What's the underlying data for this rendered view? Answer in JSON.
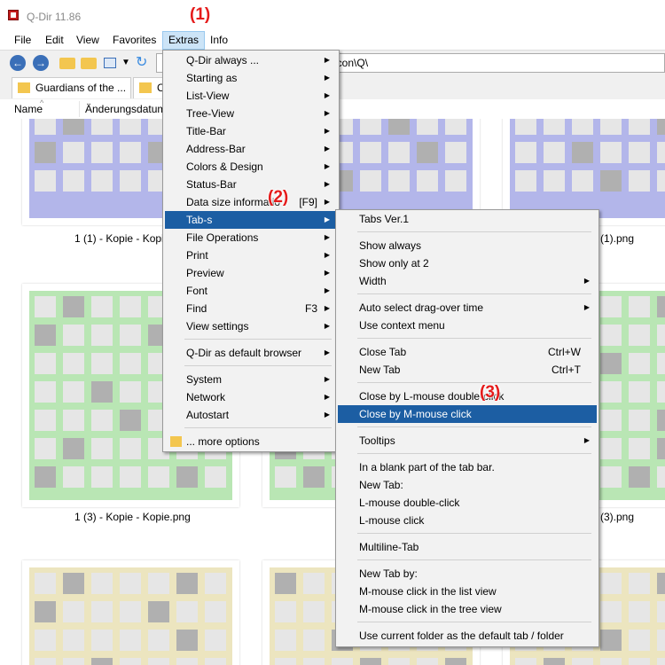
{
  "window": {
    "title": "Q-Dir 11.86"
  },
  "menubar": {
    "items": [
      "File",
      "Edit",
      "View",
      "Favorites",
      "Extras",
      "Info"
    ]
  },
  "annotations": [
    "(1)",
    "(2)",
    "(3)"
  ],
  "address": {
    "path_visible": "g\\icon\\Q\\"
  },
  "tabs": {
    "items": [
      "Guardians of the ...",
      "C"
    ]
  },
  "columns": {
    "name": "Name",
    "date": "Änderungsdatum"
  },
  "files": {
    "captions": [
      "1 (1) - Kopie - Kopie",
      "(1).png",
      "1 (3) - Kopie - Kopie.png",
      "(3).png"
    ]
  },
  "extras_menu": {
    "items": [
      {
        "label": "Q-Dir always ...",
        "submenu": true
      },
      {
        "label": "Starting as",
        "submenu": true
      },
      {
        "label": "List-View",
        "submenu": true
      },
      {
        "label": "Tree-View",
        "submenu": true
      },
      {
        "label": "Title-Bar",
        "submenu": true
      },
      {
        "label": "Address-Bar",
        "submenu": true
      },
      {
        "label": "Colors & Design",
        "submenu": true
      },
      {
        "label": "Status-Bar",
        "submenu": true
      },
      {
        "label": "Data size informatio",
        "shortcut": "[F9]",
        "submenu": true
      },
      {
        "label": "Tab-s",
        "submenu": true,
        "highlighted": true
      },
      {
        "label": "File Operations",
        "submenu": true
      },
      {
        "label": "Print",
        "submenu": true
      },
      {
        "label": "Preview",
        "submenu": true
      },
      {
        "label": "Font",
        "submenu": true
      },
      {
        "label": "Find",
        "shortcut": "F3",
        "submenu": true
      },
      {
        "label": "View settings",
        "submenu": true
      },
      {
        "separator": true
      },
      {
        "label": "Q-Dir as default browser",
        "submenu": true
      },
      {
        "separator": true
      },
      {
        "label": "System",
        "submenu": true
      },
      {
        "label": "Network",
        "submenu": true
      },
      {
        "label": "Autostart",
        "submenu": true
      },
      {
        "separator": true
      },
      {
        "label": "... more options",
        "icon": "folder-icon"
      }
    ]
  },
  "tabs_menu": {
    "items": [
      {
        "label": "Tabs Ver.1"
      },
      {
        "separator": true
      },
      {
        "label": "Show always"
      },
      {
        "label": "Show only at 2"
      },
      {
        "label": "Width",
        "submenu": true
      },
      {
        "separator": true
      },
      {
        "label": "Auto select drag-over time",
        "submenu": true
      },
      {
        "label": "Use context menu"
      },
      {
        "separator": true
      },
      {
        "label": "Close Tab",
        "shortcut": "Ctrl+W"
      },
      {
        "label": "New Tab",
        "shortcut": "Ctrl+T"
      },
      {
        "separator": true
      },
      {
        "label": "Close by L-mouse double-click"
      },
      {
        "label": "Close by M-mouse click",
        "highlighted": true
      },
      {
        "separator": true
      },
      {
        "label": "Tooltips",
        "submenu": true
      },
      {
        "separator": true
      },
      {
        "label": "In a blank part of the tab bar."
      },
      {
        "label": "New Tab:"
      },
      {
        "label": "L-mouse double-click"
      },
      {
        "label": "L-mouse click"
      },
      {
        "separator": true
      },
      {
        "label": "Multiline-Tab"
      },
      {
        "separator": true
      },
      {
        "label": "New Tab by:"
      },
      {
        "label": "M-mouse click in the list view"
      },
      {
        "label": "M-mouse click in the tree view"
      },
      {
        "separator": true
      },
      {
        "label": "Use current folder as the default tab / folder"
      }
    ]
  },
  "colors": {
    "menu_highlight": "#1c5ea3",
    "annotation": "#e51b1b",
    "thumb_blue": "#b3b6ea",
    "thumb_green": "#b9e6b4",
    "thumb_beige": "#ece5bf",
    "tile_light": "#e6e6e6",
    "tile_gray": "#b0b0b0"
  }
}
